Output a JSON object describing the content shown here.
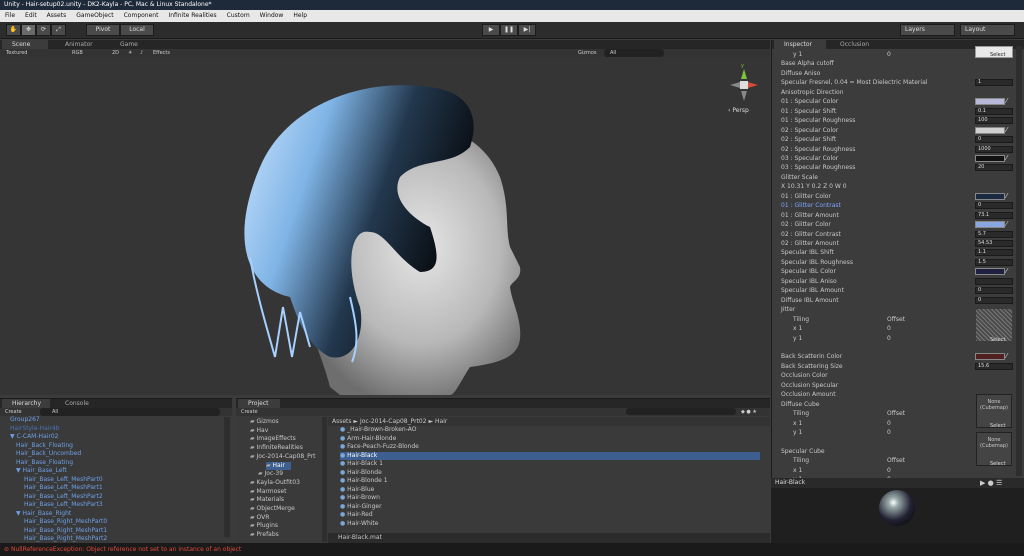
{
  "window": {
    "title": "Unity - Hair-setup02.unity - DK2-Kayla - PC, Mac & Linux Standalone*"
  },
  "menu": [
    "File",
    "Edit",
    "Assets",
    "GameObject",
    "Component",
    "Infinite Realities",
    "Custom",
    "Window",
    "Help"
  ],
  "toolbar": {
    "pivot": "Pivot",
    "local": "Local",
    "layers": "Layers",
    "layout": "Layout"
  },
  "scene_tabs": {
    "scene": "Scene",
    "animator": "Animator",
    "game": "Game"
  },
  "scene_bar": {
    "shading": "Textured",
    "render": "RGB",
    "mode2d": "2D",
    "effects": "Effects",
    "gizmos": "Gizmos",
    "search": "All"
  },
  "gizmo": {
    "persp": "Persp",
    "x": "x",
    "y": "y",
    "z": "z"
  },
  "inspector": {
    "tab": "Inspector",
    "tab2": "Occlusion",
    "select": "Select",
    "rows": [
      {
        "label": "y  1",
        "val": "0"
      },
      {
        "label": "Base Alpha cutoff",
        "val": ""
      },
      {
        "label": "Diffuse Aniso",
        "val": ""
      },
      {
        "label": "Specular Fresnel, 0.04 = Most Dielectric Material",
        "val": "1"
      },
      {
        "label": "Anisotropic Direction",
        "val": ""
      },
      {
        "label": "01 : Specular Color",
        "val": ""
      },
      {
        "label": "01 : Specular Shift",
        "val": "0.1"
      },
      {
        "label": "01 : Specular Roughness",
        "val": "100"
      },
      {
        "label": "02 : Specular Color",
        "val": ""
      },
      {
        "label": "02 : Specular Shift",
        "val": "0"
      },
      {
        "label": "02 : Specular Roughness",
        "val": "1000"
      },
      {
        "label": "03 : Specular Color",
        "val": ""
      },
      {
        "label": "03 : Specular Roughness",
        "val": "20"
      },
      {
        "label": "Glitter Scale",
        "val": ""
      },
      {
        "label": "X 10.31       Y 0.2       Z 0        W 0",
        "val": ""
      },
      {
        "label": "01 : Glitter Color",
        "val": ""
      },
      {
        "label": "01 : Glitter Contrast",
        "val": "0"
      },
      {
        "label": "01 : Glitter Amount",
        "val": "73.1"
      },
      {
        "label": "02 : Glitter Color",
        "val": ""
      },
      {
        "label": "02 : Glitter Contrast",
        "val": "5.7"
      },
      {
        "label": "02 : Glitter Amount",
        "val": "54.53"
      },
      {
        "label": "Specular IBL Shift",
        "val": "1.1"
      },
      {
        "label": "Specular IBL Roughness",
        "val": "1.5"
      },
      {
        "label": "Specular IBL Color",
        "val": ""
      },
      {
        "label": "Specular IBL Aniso",
        "val": ""
      },
      {
        "label": "Specular IBL Amount",
        "val": "0"
      },
      {
        "label": "Diffuse IBL Amount",
        "val": "0"
      },
      {
        "label": "Jitter",
        "val": ""
      },
      {
        "label": "Tiling",
        "val": "Offset"
      },
      {
        "label": "x  1",
        "val": "0"
      },
      {
        "label": "y  1",
        "val": "0"
      },
      {
        "label": "",
        "val": ""
      },
      {
        "label": "Back Scatterin Color",
        "val": ""
      },
      {
        "label": "Back Scattering Size",
        "val": "15.6"
      },
      {
        "label": "Occlusion Color",
        "val": ""
      },
      {
        "label": "Occlusion Specular",
        "val": ""
      },
      {
        "label": "Occlusion Amount",
        "val": ""
      },
      {
        "label": "Diffuse Cube",
        "val": ""
      },
      {
        "label": "Tiling",
        "val": "Offset"
      },
      {
        "label": "x  1",
        "val": "0"
      },
      {
        "label": "y  1",
        "val": "0"
      },
      {
        "label": "",
        "val": ""
      },
      {
        "label": "Specular Cube",
        "val": ""
      },
      {
        "label": "Tiling",
        "val": "Offset"
      },
      {
        "label": "x  1",
        "val": "0"
      },
      {
        "label": "y  1",
        "val": "0"
      }
    ],
    "cube1": "None (Cubemap)",
    "cube2": "None (Cubemap)",
    "preview_title": "Hair-Black"
  },
  "hierarchy": {
    "tab": "Hierarchy",
    "tab2": "Console",
    "create": "Create",
    "search": "All",
    "items": [
      "Group267",
      "HairStyle-Hair4b",
      "C-CAM-Hair02",
      "Hair_Back_Floating",
      "Hair_Back_Uncombed",
      "Hair_Base_Floating",
      "Hair_Base_Left",
      "Hair_Base_Left_MeshPart0",
      "Hair_Base_Left_MeshPart1",
      "Hair_Base_Left_MeshPart2",
      "Hair_Base_Left_MeshPart3",
      "Hair_Base_Right",
      "Hair_Base_Right_MeshPart0",
      "Hair_Base_Right_MeshPart1",
      "Hair_Base_Right_MeshPart2"
    ]
  },
  "project": {
    "tab": "Project",
    "create": "Create",
    "folders": [
      "Gizmos",
      "Hav",
      "ImageEffects",
      "InfiniteRealities",
      "Joc-2014-Cap08_Prt",
      "Hair",
      "Joc-39",
      "Kayla-Outfit03",
      "Marmoset",
      "Materials",
      "ObjectMerge",
      "OVR",
      "Plugins",
      "Prefabs"
    ],
    "breadcrumb": "Assets ► Joc-2014-Cap08_Prt02 ► Hair",
    "files": [
      "_Hair-Brown-Broken-AO",
      "Arm-Hair-Blonde",
      "Face-Peach-Fuzz-Blonde",
      "Hair-Black",
      "Hair-Black 1",
      "Hair-Blonde",
      "Hair-Blonde 1",
      "Hair-Blue",
      "Hair-Brown",
      "Hair-Ginger",
      "Hair-Red",
      "Hair-White"
    ],
    "footer": "Hair-Black.mat"
  },
  "status": {
    "error": "NullReferenceException: Object reference not set to an instance of an object"
  },
  "colors": {
    "swatch1": "#b8b8d8",
    "swatch2": "#d0d0d0",
    "swatch3": "#111111",
    "swatch4": "#1a2a40",
    "swatch5": "#8aa6e0",
    "swatch6": "#202040",
    "swatch7": "#502020"
  }
}
